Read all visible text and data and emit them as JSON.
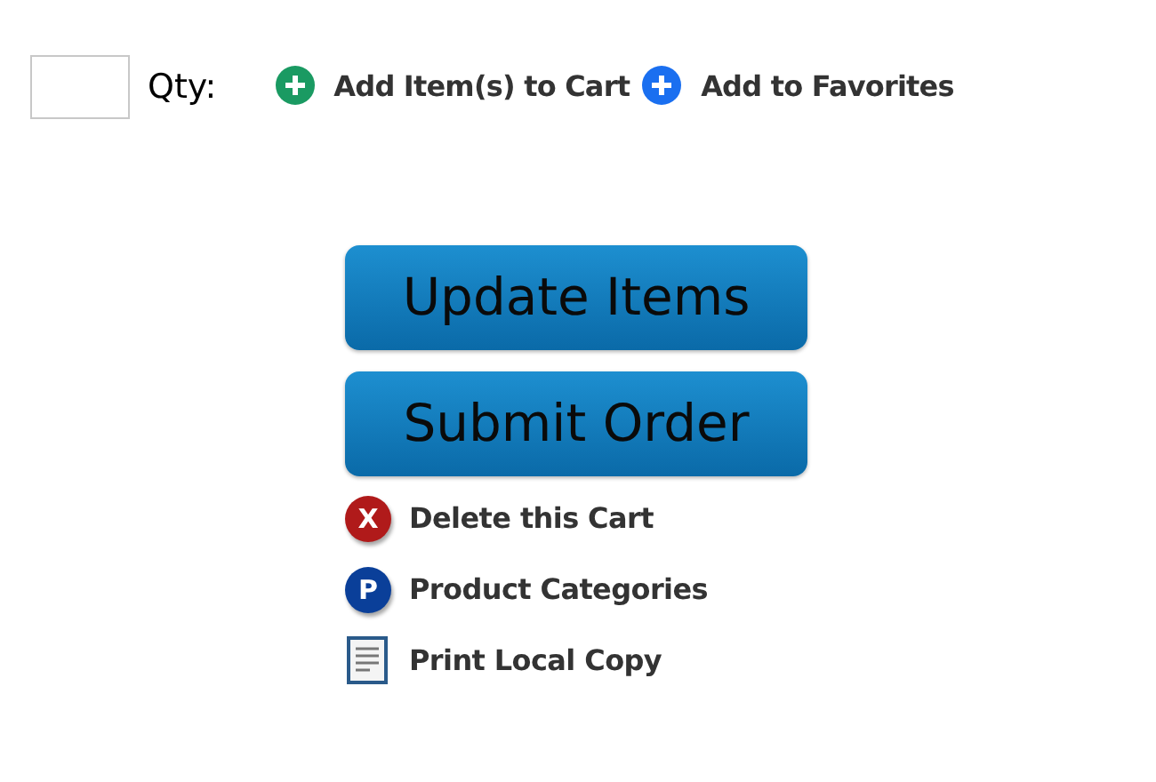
{
  "quantity": {
    "label": "Qty:"
  },
  "actions": [
    {
      "label": "Add Item(s) to Cart",
      "color": "#1a9a62"
    },
    {
      "label": "Add to Favorites",
      "color": "#1a6ff0"
    }
  ],
  "buttons": [
    "Update Items",
    "Submit Order"
  ],
  "links": [
    {
      "kind": "badge",
      "glyph": "X",
      "color": "#b01a1a",
      "label": "Delete this Cart"
    },
    {
      "kind": "badge",
      "glyph": "P",
      "color": "#0a3f99",
      "label": "Product Categories"
    },
    {
      "kind": "document",
      "label": "Print Local Copy"
    }
  ]
}
